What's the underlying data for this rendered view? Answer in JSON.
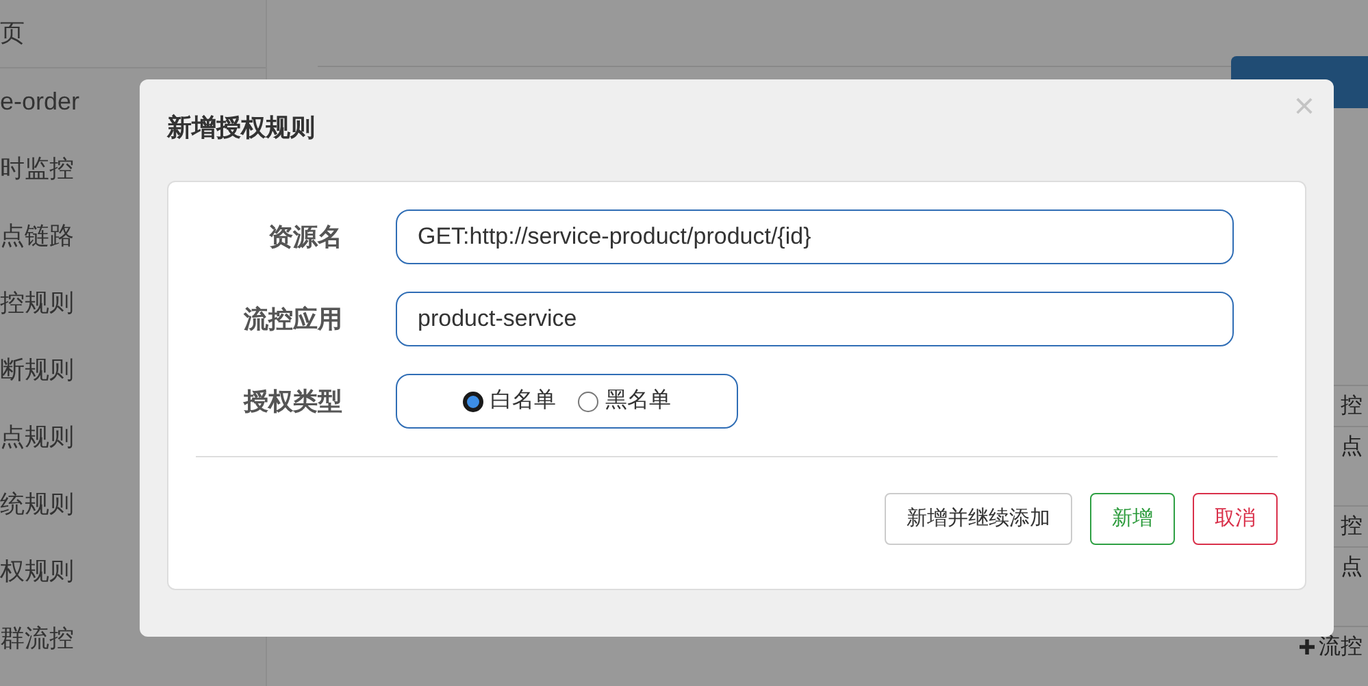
{
  "sidebar": {
    "items": [
      {
        "label": "页"
      },
      {
        "label": "e-order"
      },
      {
        "label": "时监控"
      },
      {
        "label": "点链路"
      },
      {
        "label": "控规则"
      },
      {
        "label": "断规则"
      },
      {
        "label": "点规则"
      },
      {
        "label": "统规则"
      },
      {
        "label": "权规则"
      },
      {
        "label": "群流控"
      }
    ]
  },
  "page": {
    "actions": [
      {
        "label": "控",
        "kind": "cut"
      },
      {
        "label": "点",
        "kind": "cut"
      },
      {
        "label": "控",
        "kind": "cut"
      },
      {
        "label": "点",
        "kind": "cut"
      },
      {
        "label": "流控",
        "kind": "plus"
      }
    ]
  },
  "dialog": {
    "title": "新增授权规则",
    "close": "×",
    "fields": [
      {
        "label": "资源名",
        "value": "GET:http://service-product/product/{id}"
      },
      {
        "label": "流控应用",
        "value": "product-service"
      }
    ],
    "auth_type": {
      "label": "授权类型",
      "options": [
        {
          "label": "白名单",
          "selected": true
        },
        {
          "label": "黑名单",
          "selected": false
        }
      ]
    },
    "buttons": [
      {
        "label": "新增并继续添加",
        "kind": "default"
      },
      {
        "label": "新增",
        "kind": "success"
      },
      {
        "label": "取消",
        "kind": "danger"
      }
    ]
  }
}
